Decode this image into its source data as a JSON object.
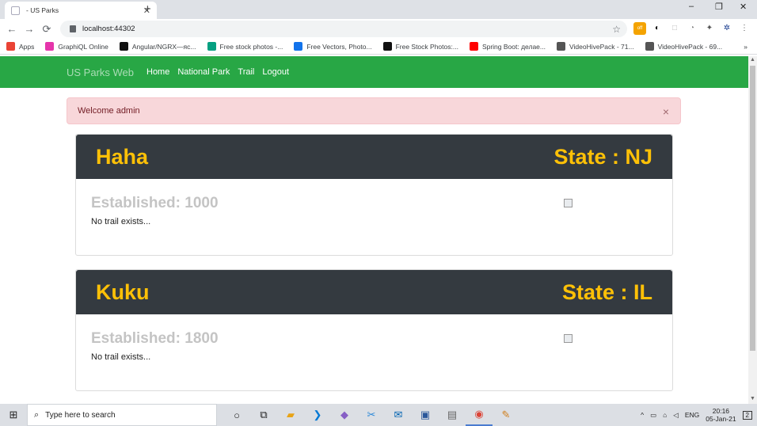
{
  "browser": {
    "tab_title": "- US Parks",
    "tab_close": "✕",
    "new_tab": "+",
    "window_controls": [
      "–",
      "❐",
      "✕"
    ],
    "url": "localhost:44302",
    "star": "☆",
    "nav": {
      "back": "←",
      "forward": "→",
      "reload": "⟳"
    },
    "extension_icons": [
      "off",
      "◐",
      "□",
      "◔",
      "✦",
      "✲",
      "⋮"
    ],
    "bookmarks": [
      {
        "label": "Apps",
        "icon": "apps-icon",
        "color": "#ea4335"
      },
      {
        "label": "GraphiQL Online",
        "icon": "graphql-icon",
        "color": "#e535ab"
      },
      {
        "label": "Angular/NGRX—яс...",
        "icon": "medium-icon",
        "color": "#111111"
      },
      {
        "label": "Free stock photos -...",
        "icon": "pexels-icon",
        "color": "#05a081"
      },
      {
        "label": "Free Vectors, Photo...",
        "icon": "freepik-icon",
        "color": "#1273eb"
      },
      {
        "label": "Free Stock Photos:...",
        "icon": "b-icon",
        "color": "#111111"
      },
      {
        "label": "Spring Boot: делае...",
        "icon": "youtube-icon",
        "color": "#ff0000"
      },
      {
        "label": "VideoHivePack - 71...",
        "icon": "videohive-icon",
        "color": "#555555"
      },
      {
        "label": "VideoHivePack - 69...",
        "icon": "videohive-icon",
        "color": "#555555"
      }
    ],
    "bookmarks_more": "»"
  },
  "app": {
    "brand": "US Parks Web",
    "nav": [
      "Home",
      "National Park",
      "Trail",
      "Logout"
    ],
    "alert": {
      "text": "Welcome admin",
      "close": "×"
    },
    "parks": [
      {
        "name": "Haha",
        "state": "State : NJ",
        "established": "Established: 1000",
        "trail_message": "No trail exists..."
      },
      {
        "name": "Kuku",
        "state": "State : IL",
        "established": "Established: 1800",
        "trail_message": "No trail exists..."
      }
    ],
    "colors": {
      "navbar": "#28a745",
      "card_header": "#343a40",
      "card_title": "#ffc107",
      "alert_bg": "#f8d7da"
    }
  },
  "taskbar": {
    "start": "⊞",
    "search_placeholder": "Type here to search",
    "search_icon": "⌕",
    "apps": [
      {
        "name": "cortana-icon",
        "glyph": "○",
        "color": "#222222"
      },
      {
        "name": "task-view-icon",
        "glyph": "⧉",
        "color": "#222222"
      },
      {
        "name": "file-explorer-icon",
        "glyph": "▰",
        "color": "#e8a317"
      },
      {
        "name": "vscode-icon",
        "glyph": "❯",
        "color": "#0078d4"
      },
      {
        "name": "visual-studio-icon",
        "glyph": "◆",
        "color": "#865fc5"
      },
      {
        "name": "snip-icon",
        "glyph": "✂",
        "color": "#2b88d8"
      },
      {
        "name": "mail-icon",
        "glyph": "✉",
        "color": "#0063b1"
      },
      {
        "name": "remote-desktop-icon",
        "glyph": "▣",
        "color": "#2b579a"
      },
      {
        "name": "app-icon",
        "glyph": "▤",
        "color": "#666666"
      },
      {
        "name": "chrome-icon",
        "glyph": "◉",
        "color": "#db4437"
      },
      {
        "name": "paint-icon",
        "glyph": "✎",
        "color": "#d08020"
      }
    ],
    "tray": {
      "chevron": "^",
      "lang": "ENG",
      "time": "20:16",
      "date": "05-Jan-21",
      "notifications": "2"
    }
  }
}
